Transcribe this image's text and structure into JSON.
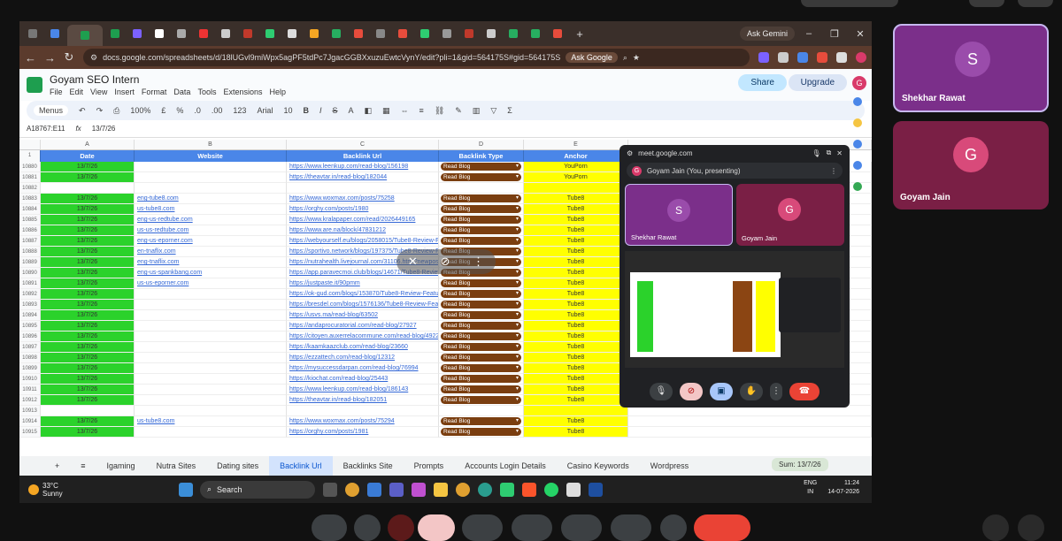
{
  "meet": {
    "participants": [
      {
        "initial": "S",
        "name": "Shekhar Rawat"
      },
      {
        "initial": "G",
        "name": "Goyam Jain"
      }
    ]
  },
  "browser": {
    "ask_gemini": "Ask Gemini",
    "url": "docs.google.com/spreadsheets/d/18lUGvl9miWpx5agPF5tdPc7JgacGGBXxuzuEwtcVynY/edit?pli=1&gid=564175S#gid=564175S",
    "ask_google": "Ask Google"
  },
  "sheet": {
    "title": "Goyam SEO Intern",
    "menus": [
      "File",
      "Edit",
      "View",
      "Insert",
      "Format",
      "Data",
      "Tools",
      "Extensions",
      "Help"
    ],
    "share": "Share",
    "upgrade": "Upgrade",
    "avatar": "G",
    "toolbar": {
      "search": "Menus",
      "zoom": "100%",
      "currency": "£",
      "percent": "%",
      "dec1": ".0",
      "dec2": ".00",
      "fmt": "123",
      "font": "Arial",
      "size": "10"
    },
    "cell_ref": "A18767:E11",
    "formula": "13/7/26",
    "columns": [
      "A",
      "B",
      "C",
      "D",
      "E"
    ],
    "headers": [
      "Date",
      "Website",
      "Backlink Url",
      "Backlink Type",
      "Anchor"
    ],
    "rows": [
      {
        "n": "10880",
        "date": "13/7/26",
        "site": "",
        "url": "https://www.leenkup.com/read-blog/156198",
        "type": "Read Blog",
        "anchor": "YouPorn"
      },
      {
        "n": "10881",
        "date": "13/7/26",
        "site": "",
        "url": "https://theavtar.in/read-blog/182044",
        "type": "Read Blog",
        "anchor": "YouPorn"
      },
      {
        "n": "10882",
        "date": "",
        "site": "",
        "url": "",
        "type": "",
        "anchor": ""
      },
      {
        "n": "10883",
        "date": "13/7/26",
        "site": "eng-tube8.com",
        "url": "https://www.woxmax.com/posts/75258",
        "type": "Read Blog",
        "anchor": "Tube8"
      },
      {
        "n": "10884",
        "date": "13/7/26",
        "site": "us-tube8.com",
        "url": "https://orghy.com/posts/1980",
        "type": "Read Blog",
        "anchor": "Tube8"
      },
      {
        "n": "10885",
        "date": "13/7/26",
        "site": "eng-us-redtube.com",
        "url": "https://www.kralapaper.com/read/2026449165",
        "type": "Read Blog",
        "anchor": "Tube8"
      },
      {
        "n": "10886",
        "date": "13/7/26",
        "site": "us-us-redtube.com",
        "url": "https://www.are.na/block/47831212",
        "type": "Read Blog",
        "anchor": "Tube8"
      },
      {
        "n": "10887",
        "date": "13/7/26",
        "site": "eng-us-eporner.com",
        "url": "https://webyourself.eu/blogs/2058015/Tube8-Review-Fe",
        "type": "Read Blog",
        "anchor": "Tube8"
      },
      {
        "n": "10888",
        "date": "13/7/26",
        "site": "en-tnaflix.com",
        "url": "https://sportivo.network/blogs/197375/Tube8-Review-F",
        "type": "Read Blog",
        "anchor": "Tube8"
      },
      {
        "n": "10889",
        "date": "13/7/26",
        "site": "eng-tnaflix.com",
        "url": "https://nutrahealth.livejournal.com/31106.html?newpos",
        "type": "Read Blog",
        "anchor": "Tube8"
      },
      {
        "n": "10890",
        "date": "13/7/26",
        "site": "eng-us-spankbang.com",
        "url": "https://app.paravecmoi.club/blogs/14671/Tube8-Review-Fea",
        "type": "Read Blog",
        "anchor": "Tube8"
      },
      {
        "n": "10891",
        "date": "13/7/26",
        "site": "us-us-eporner.com",
        "url": "https://justpaste.it/90pmm",
        "type": "Read Blog",
        "anchor": "Tube8"
      },
      {
        "n": "10892",
        "date": "13/7/26",
        "site": "",
        "url": "https://ok-gud.com/blogs/153870/Tube8-Review-Features",
        "type": "Read Blog",
        "anchor": "Tube8"
      },
      {
        "n": "10893",
        "date": "13/7/26",
        "site": "",
        "url": "https://bresdel.com/blogs/1576136/Tube8-Review-Features-V",
        "type": "Read Blog",
        "anchor": "Tube8"
      },
      {
        "n": "10894",
        "date": "13/7/26",
        "site": "",
        "url": "https://usvs.ma/read-blog/63502",
        "type": "Read Blog",
        "anchor": "Tube8"
      },
      {
        "n": "10895",
        "date": "13/7/26",
        "site": "",
        "url": "https://andaprocuratorial.com/read-blog/27927",
        "type": "Read Blog",
        "anchor": "Tube8"
      },
      {
        "n": "10896",
        "date": "13/7/26",
        "site": "",
        "url": "https://citoyen.auxerrelacommune.com/read-blog/49220",
        "type": "Read Blog",
        "anchor": "Tube8"
      },
      {
        "n": "10897",
        "date": "13/7/26",
        "site": "",
        "url": "https://kaamkaazclub.com/read-blog/23660",
        "type": "Read Blog",
        "anchor": "Tube8"
      },
      {
        "n": "10898",
        "date": "13/7/26",
        "site": "",
        "url": "https://ezzattech.com/read-blog/12312",
        "type": "Read Blog",
        "anchor": "Tube8"
      },
      {
        "n": "10899",
        "date": "13/7/26",
        "site": "",
        "url": "https://mysuccessdarpan.com/read-blog/76994",
        "type": "Read Blog",
        "anchor": "Tube8"
      },
      {
        "n": "10910",
        "date": "13/7/26",
        "site": "",
        "url": "https://kiochat.com/read-blog/25443",
        "type": "Read Blog",
        "anchor": "Tube8"
      },
      {
        "n": "10911",
        "date": "13/7/26",
        "site": "",
        "url": "https://www.leenkup.com/read-blog/186143",
        "type": "Read Blog",
        "anchor": "Tube8"
      },
      {
        "n": "10912",
        "date": "13/7/26",
        "site": "",
        "url": "https://theavtar.in/read-blog/182051",
        "type": "Read Blog",
        "anchor": "Tube8"
      },
      {
        "n": "10913",
        "date": "",
        "site": "",
        "url": "",
        "type": "",
        "anchor": ""
      },
      {
        "n": "10914",
        "date": "13/7/26",
        "site": "us-tube8.com",
        "url": "https://www.woxmax.com/posts/75294",
        "type": "Read Blog",
        "anchor": "Tube8"
      },
      {
        "n": "10915",
        "date": "13/7/26",
        "site": "",
        "url": "https://orghy.com/posts/1981",
        "type": "Read Blog",
        "anchor": "Tube8"
      }
    ],
    "tabs": [
      "Igaming",
      "Nutra Sites",
      "Dating sites",
      "Backlink Url",
      "Backlinks Site",
      "Prompts",
      "Accounts Login Details",
      "Casino Keywords",
      "Wordpress"
    ],
    "sum": "Sum: 13/7/26"
  },
  "pip": {
    "url": "meet.google.com",
    "presenting": "Goyam Jain (You, presenting)"
  },
  "taskbar": {
    "temp": "33°C",
    "weather": "Sunny",
    "search": "Search",
    "lang1": "ENG",
    "lang2": "IN",
    "time": "11:24",
    "date": "14-07-2026"
  },
  "colors": {
    "green": "#2bd22b",
    "yellow": "#ffff00",
    "brown": "#7a3e10",
    "header_blue": "#4a86e8"
  }
}
